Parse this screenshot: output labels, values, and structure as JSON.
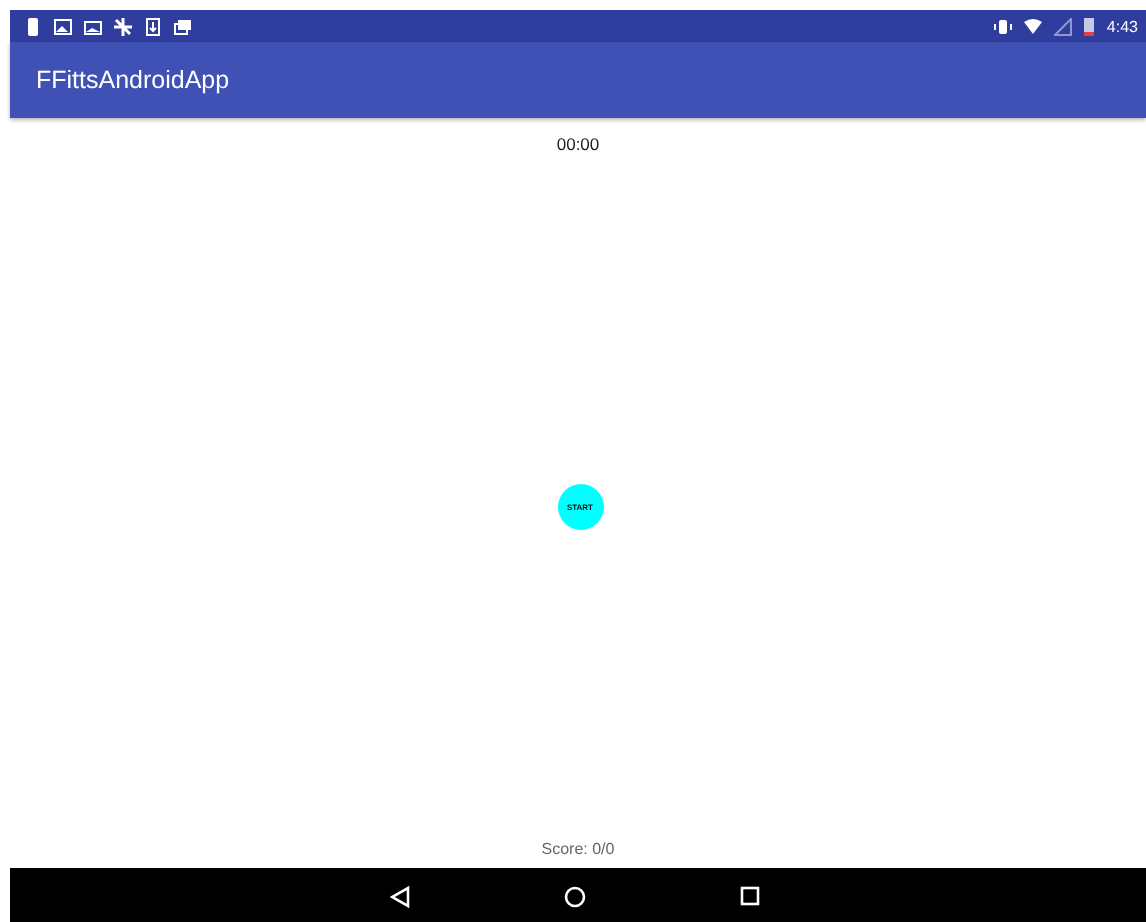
{
  "status_bar": {
    "time": "4:43"
  },
  "app_bar": {
    "title": "FFittsAndroidApp"
  },
  "timer": "00:00",
  "start_button": {
    "label": "START"
  },
  "score": "Score: 0/0"
}
